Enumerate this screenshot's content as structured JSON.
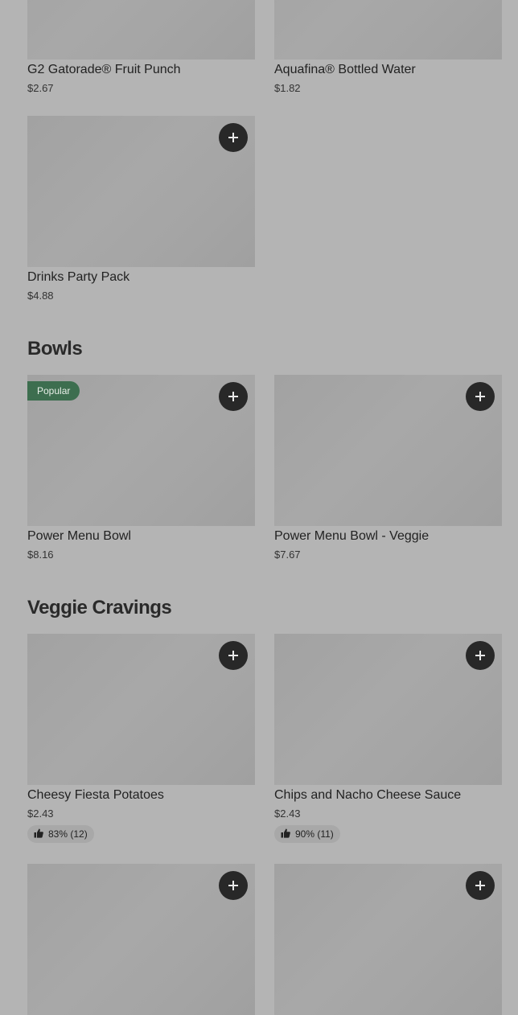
{
  "sections": [
    {
      "title": "",
      "items": [
        {
          "name": "G2 Gatorade® Fruit Punch",
          "price": "$2.67"
        },
        {
          "name": "Aquafina® Bottled Water",
          "price": "$1.82"
        },
        {
          "name": "Drinks Party Pack",
          "price": "$4.88",
          "add_icon": "plus-icon"
        }
      ]
    },
    {
      "title": "Bowls",
      "items": [
        {
          "name": "Power Menu Bowl",
          "price": "$8.16",
          "badge": "Popular",
          "add_icon": "plus-icon"
        },
        {
          "name": "Power Menu Bowl - Veggie",
          "price": "$7.67",
          "add_icon": "plus-icon"
        }
      ]
    },
    {
      "title": "Veggie Cravings",
      "items": [
        {
          "name": "Cheesy Fiesta Potatoes",
          "price": "$2.43",
          "rating": "83% (12)",
          "rating_icon": "thumbs-up-icon",
          "add_icon": "plus-icon"
        },
        {
          "name": "Chips and Nacho Cheese Sauce",
          "price": "$2.43",
          "rating": "90% (11)",
          "rating_icon": "thumbs-up-icon",
          "add_icon": "plus-icon"
        }
      ]
    }
  ],
  "colors": {
    "background": "#b4b4b4",
    "image_placeholder": "#a6a6a6",
    "add_button": "#282828",
    "badge": "#3d6e4f"
  }
}
